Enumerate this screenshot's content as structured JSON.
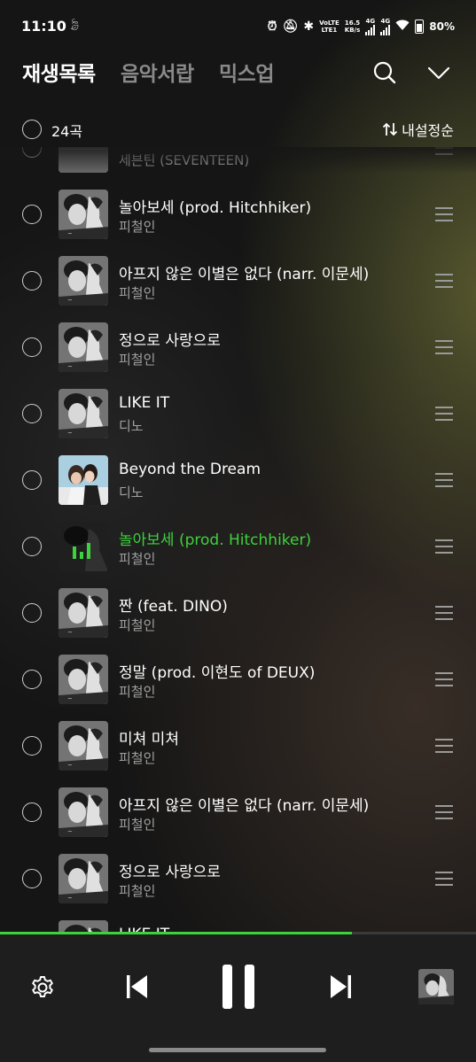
{
  "status_bar": {
    "time": "11:10",
    "net_speed_value": "16.5",
    "net_speed_unit": "KB/s",
    "volte_top": "VoLTE",
    "volte_bottom": "LTE1",
    "net_1": "4G",
    "net_2": "4G",
    "battery": "80%"
  },
  "header": {
    "tabs": [
      {
        "label": "재생목록",
        "active": true
      },
      {
        "label": "음악서랍",
        "active": false
      },
      {
        "label": "믹스업",
        "active": false
      }
    ]
  },
  "toolbar": {
    "count_label": "24곡",
    "sort_label": "내설정순",
    "sort_icon": "sort-arrows-icon"
  },
  "playlist": [
    {
      "title": "",
      "artist": "세븐틴 (SEVENTEEN)",
      "art": "seventeen-art",
      "playing": false
    },
    {
      "title": "놀아보세 (prod. Hitchhiker)",
      "artist": "피철인",
      "art": "album-bw",
      "playing": false
    },
    {
      "title": "아프지 않은 이별은 없다 (narr. 이문세)",
      "artist": "피철인",
      "art": "album-bw",
      "playing": false
    },
    {
      "title": "정으로 사랑으로",
      "artist": "피철인",
      "art": "album-bw",
      "playing": false
    },
    {
      "title": "LIKE IT",
      "artist": "디노",
      "art": "album-bw",
      "playing": false
    },
    {
      "title": "Beyond the Dream",
      "artist": "디노",
      "art": "album-color",
      "playing": false
    },
    {
      "title": "놀아보세 (prod. Hitchhiker)",
      "artist": "피철인",
      "art": "album-playing",
      "playing": true
    },
    {
      "title": "짠 (feat. DINO)",
      "artist": "피철인",
      "art": "album-bw",
      "playing": false
    },
    {
      "title": "정말 (prod. 이현도 of DEUX)",
      "artist": "피철인",
      "art": "album-bw",
      "playing": false
    },
    {
      "title": "미쳐 미쳐",
      "artist": "피철인",
      "art": "album-bw",
      "playing": false
    },
    {
      "title": "아프지 않은 이별은 없다 (narr. 이문세)",
      "artist": "피철인",
      "art": "album-bw",
      "playing": false
    },
    {
      "title": "정으로 사랑으로",
      "artist": "피철인",
      "art": "album-bw",
      "playing": false
    },
    {
      "title": "LIKE IT",
      "artist": "",
      "art": "album-bw",
      "playing": false
    }
  ],
  "player": {
    "progress_fraction": 0.74,
    "accent_color": "#3cd23c",
    "buttons": [
      "settings-icon",
      "previous-icon",
      "pause-icon",
      "next-icon",
      "now-playing-art"
    ]
  }
}
